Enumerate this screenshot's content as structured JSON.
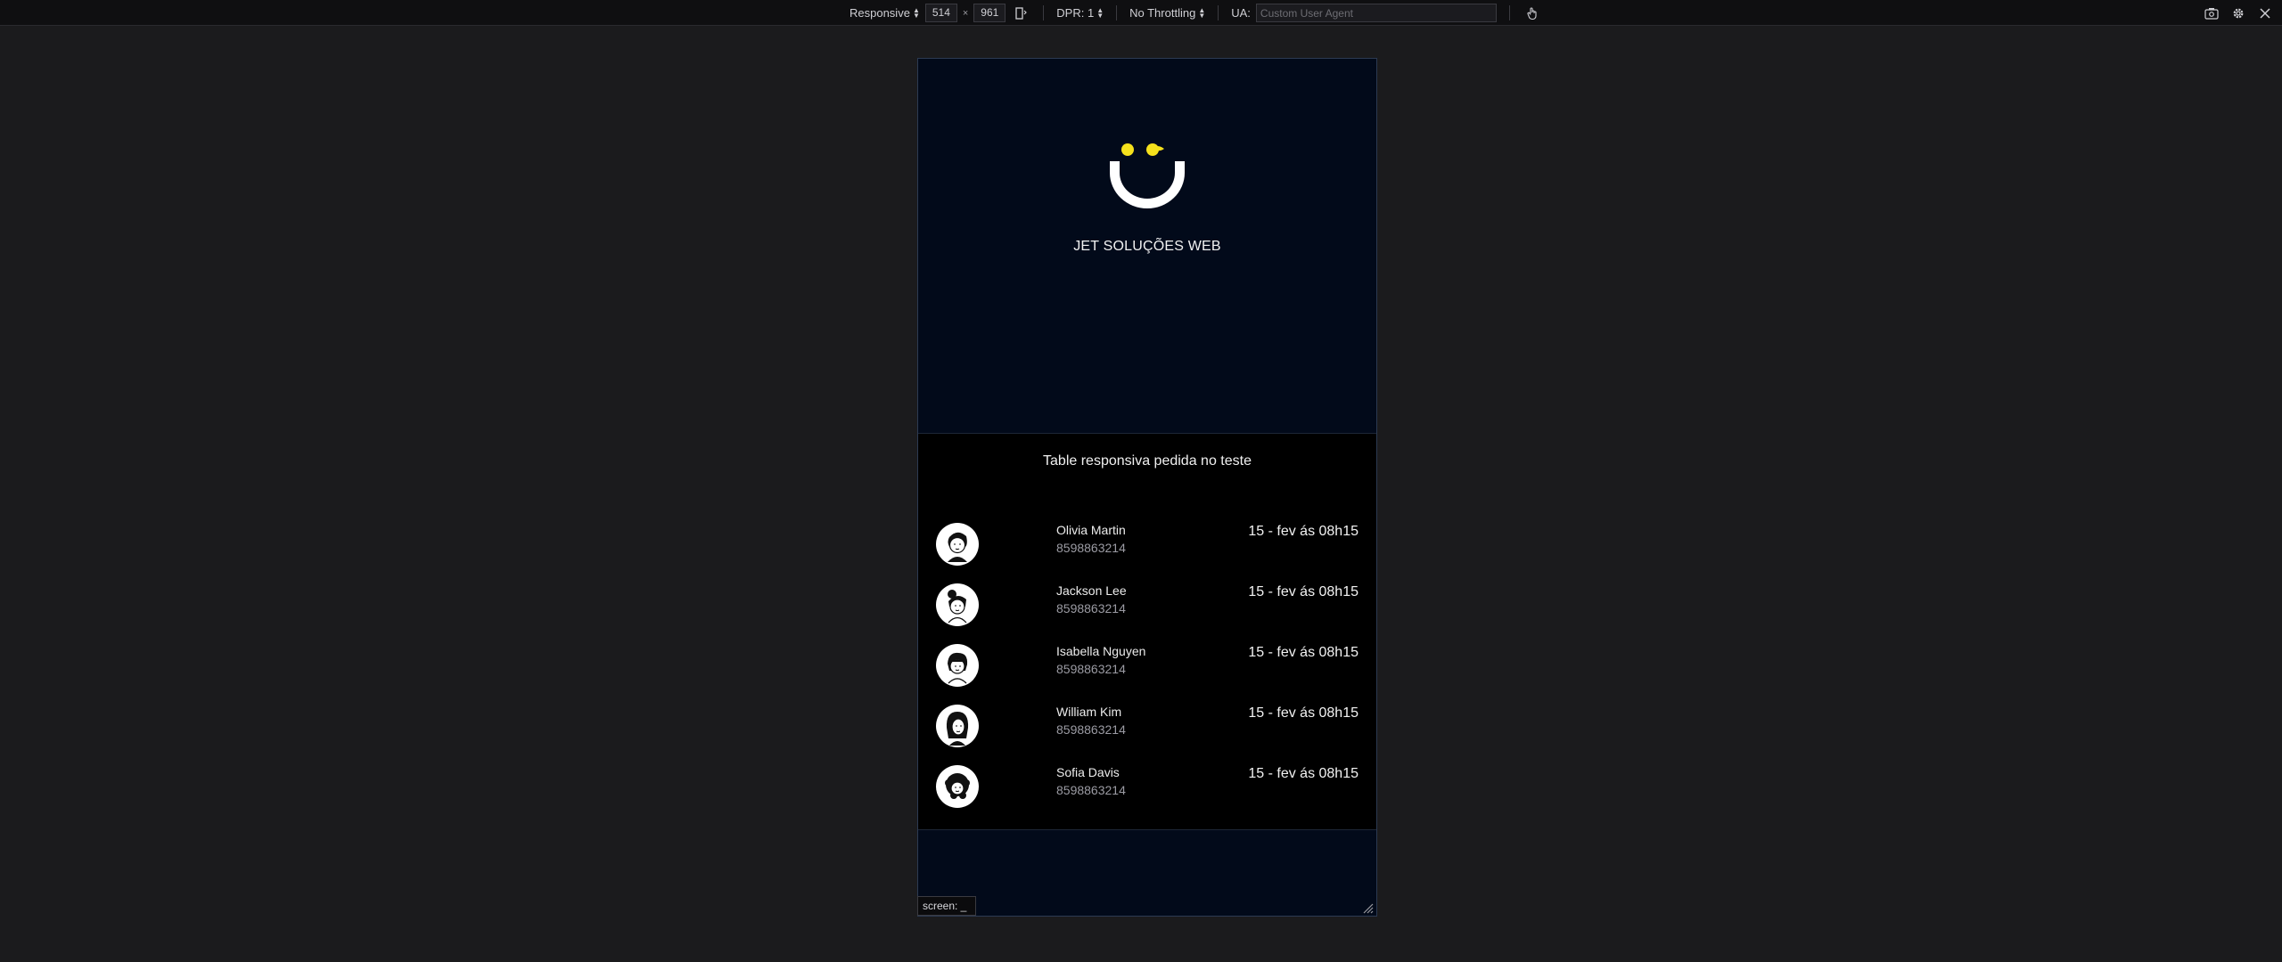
{
  "toolbar": {
    "device_mode": "Responsive",
    "width": "514",
    "height": "961",
    "times": "×",
    "dpr": "DPR: 1",
    "throttling": "No Throttling",
    "ua_label": "UA:",
    "ua_placeholder": "Custom User Agent"
  },
  "page": {
    "brand": "JET SOLUÇÕES WEB",
    "table_title": "Table responsiva pedida no teste",
    "rows": [
      {
        "name": "Olivia Martin",
        "phone": "8598863214",
        "date": "15 - fev ás 08h15"
      },
      {
        "name": "Jackson Lee",
        "phone": "8598863214",
        "date": "15 - fev ás 08h15"
      },
      {
        "name": "Isabella Nguyen",
        "phone": "8598863214",
        "date": "15 - fev ás 08h15"
      },
      {
        "name": "William Kim",
        "phone": "8598863214",
        "date": "15 - fev ás 08h15"
      },
      {
        "name": "Sofia Davis",
        "phone": "8598863214",
        "date": "15 - fev ás 08h15"
      }
    ]
  },
  "screen_tag": "screen: _",
  "colors": {
    "accent_yellow": "#f5e11c",
    "hero_bg": "#020a1a",
    "table_bg": "#000000"
  },
  "icons": [
    "rotate-device-icon",
    "touch-icon",
    "screenshot-icon",
    "settings-icon",
    "close-icon",
    "resize-handle-icon"
  ]
}
